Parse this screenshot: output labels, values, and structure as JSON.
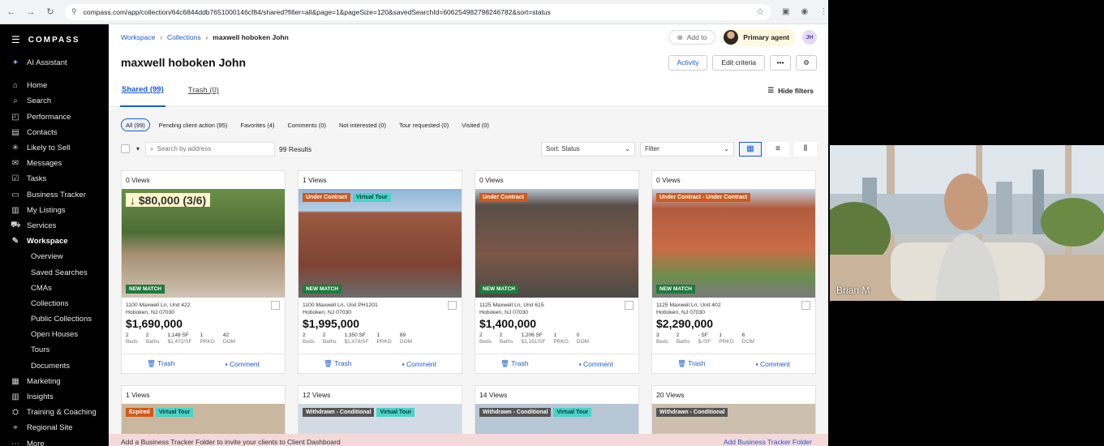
{
  "browser": {
    "url": "compass.com/app/collection/64c6844ddb7651000146cf84/shared?filter=all&page=1&pageSize=120&savedSearchId=606254982798246782&sort=status"
  },
  "sidebar": {
    "brand": "COMPASS",
    "ai_assistant": "AI Assistant",
    "items": [
      {
        "label": "Home",
        "icon": "home-icon"
      },
      {
        "label": "Search",
        "icon": "search-icon"
      },
      {
        "label": "Performance",
        "icon": "chart-icon"
      },
      {
        "label": "Contacts",
        "icon": "contacts-icon"
      },
      {
        "label": "Likely to Sell",
        "icon": "sparkle-icon"
      },
      {
        "label": "Messages",
        "icon": "mail-icon"
      },
      {
        "label": "Tasks",
        "icon": "tasks-icon"
      },
      {
        "label": "Business Tracker",
        "icon": "folder-icon"
      },
      {
        "label": "My Listings",
        "icon": "listings-icon"
      },
      {
        "label": "Services",
        "icon": "truck-icon"
      },
      {
        "label": "Workspace",
        "icon": "pen-icon"
      }
    ],
    "workspace_sub": [
      "Overview",
      "Saved Searches",
      "CMAs",
      "Collections",
      "Public Collections",
      "Open Houses",
      "Tours",
      "Documents"
    ],
    "items_after": [
      {
        "label": "Marketing",
        "icon": "marketing-icon"
      },
      {
        "label": "Insights",
        "icon": "insights-icon"
      },
      {
        "label": "Training & Coaching",
        "icon": "training-icon"
      },
      {
        "label": "Regional Site",
        "icon": "regional-icon"
      },
      {
        "label": "More",
        "icon": "more-icon"
      }
    ]
  },
  "header": {
    "breadcrumb": [
      "Workspace",
      "Collections",
      "maxwell hoboken John"
    ],
    "add_to": "Add to",
    "agent_label": "Primary agent",
    "user_initials": "JH"
  },
  "title": {
    "text": "maxwell hoboken John",
    "activity": "Activity",
    "edit": "Edit criteria",
    "more": "•••"
  },
  "tabs": {
    "shared": "Shared (99)",
    "trash": "Trash (0)",
    "hide_filters": "Hide filters"
  },
  "filters": {
    "chips": [
      "All (99)",
      "Pending client action (95)",
      "Favorites (4)",
      "Comments (0)",
      "Not interested (0)",
      "Tour requested (0)",
      "Visited (0)"
    ],
    "search_placeholder": "Search by address",
    "results": "99 Results",
    "sort": "Sort: Status",
    "filter": "Filter"
  },
  "cards": [
    {
      "views": "0 Views",
      "badges": [
        {
          "text": "↓ $80,000 (3/6)",
          "kind": "price"
        }
      ],
      "new_match": "NEW MATCH",
      "addr1": "1100 Maxwell Ln, Unit 422",
      "addr2": "Hoboken, NJ 07030",
      "price": "$1,690,000",
      "beds": "2",
      "baths": "2",
      "sf": "1,148 SF",
      "ppsf": "$1,472/SF",
      "prkg": "1",
      "dom": "42",
      "photo": "terrace",
      "trash": "Trash",
      "comment": "Comment"
    },
    {
      "views": "1 Views",
      "badges": [
        {
          "text": "Under Contract",
          "kind": "orange"
        },
        {
          "text": "Virtual Tour",
          "kind": "teal"
        }
      ],
      "new_match": "NEW MATCH",
      "addr1": "1100 Maxwell Ln, Unit PH1201",
      "addr2": "Hoboken, NJ 07030",
      "price": "$1,995,000",
      "beds": "2",
      "baths": "2",
      "sf": "1,350 SF",
      "ppsf": "$1,478/SF",
      "prkg": "1",
      "dom": "89",
      "photo": "brick",
      "trash": "Trash",
      "comment": "Comment"
    },
    {
      "views": "0 Views",
      "badges": [
        {
          "text": "Under Contract",
          "kind": "orange"
        }
      ],
      "new_match": "NEW MATCH",
      "addr1": "1125 Maxwell Ln, Unit 615",
      "addr2": "Hoboken, NJ 07030",
      "price": "$1,400,000",
      "beds": "2",
      "baths": "2",
      "sf": "1,206 SF",
      "ppsf": "$1,161/SF",
      "prkg": "1",
      "dom": "0",
      "photo": "tower",
      "trash": "Trash",
      "comment": "Comment"
    },
    {
      "views": "0 Views",
      "badges": [
        {
          "text": "Under Contract - Under Contract",
          "kind": "orange"
        }
      ],
      "new_match": "NEW MATCH",
      "addr1": "1125 Maxwell Ln, Unit 402",
      "addr2": "Hoboken, NJ 07030",
      "price": "$2,290,000",
      "beds": "3",
      "baths": "2",
      "sf": "- SF",
      "ppsf": "$-/SF",
      "prkg": "1",
      "dom": "6",
      "photo": "redbrick",
      "trash": "Trash",
      "comment": "Comment"
    }
  ],
  "stat_labels": {
    "beds": "Beds",
    "baths": "Baths",
    "prkg": "PRKG",
    "dom": "DOM"
  },
  "cards_row2": [
    {
      "views": "1 Views",
      "badges": [
        {
          "text": "Expired",
          "kind": "orange"
        },
        {
          "text": "Virtual Tour",
          "kind": "teal"
        }
      ]
    },
    {
      "views": "12 Views",
      "badges": [
        {
          "text": "Withdrawn - Conditional",
          "kind": "gray"
        },
        {
          "text": "Virtual Tour",
          "kind": "teal"
        }
      ]
    },
    {
      "views": "14 Views",
      "badges": [
        {
          "text": "Withdrawn - Conditional",
          "kind": "gray"
        },
        {
          "text": "Virtual Tour",
          "kind": "teal"
        }
      ]
    },
    {
      "views": "20 Views",
      "badges": [
        {
          "text": "Withdrawn - Conditional",
          "kind": "gray"
        }
      ]
    }
  ],
  "banner": {
    "text": "Add a Business Tracker Folder to invite your clients to Client Dashboard",
    "link": "Add Business Tracker Folder"
  },
  "video": {
    "name": "Brian M"
  }
}
